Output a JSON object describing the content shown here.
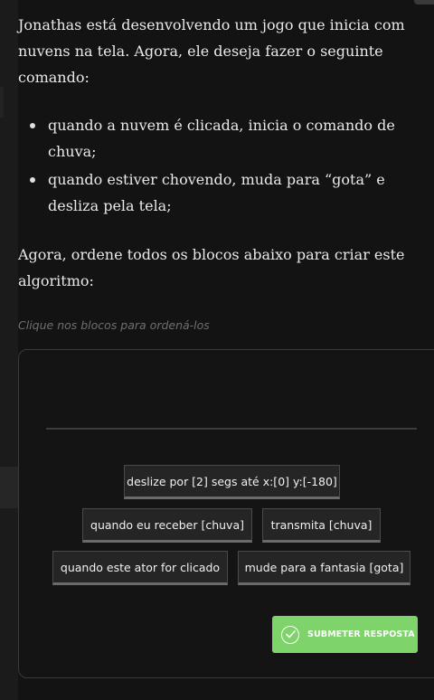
{
  "question": {
    "intro": "Jonathas está desenvolvendo um jogo que inicia com nuvens na tela. Agora, ele deseja fazer o seguinte comando:",
    "bullets": [
      "quando a nuvem é clicada, inicia o comando de chuva;",
      "quando estiver chovendo, muda para “gota” e desliza pela tela;"
    ],
    "instruction": "Agora, ordene todos os blocos abaixo para criar este algoritmo:",
    "hint": "Clique nos blocos para ordená-los"
  },
  "blocks": [
    "deslize por [2] segs até x:[0] y:[-180]",
    "quando eu receber [chuva]",
    "transmita [chuva]",
    "quando este ator for clicado",
    "mude para a fantasia [gota]"
  ],
  "submit": {
    "label": "SUBMETER RESPOSTA",
    "icon": "check-circle-icon",
    "color": "#7ed36a"
  }
}
